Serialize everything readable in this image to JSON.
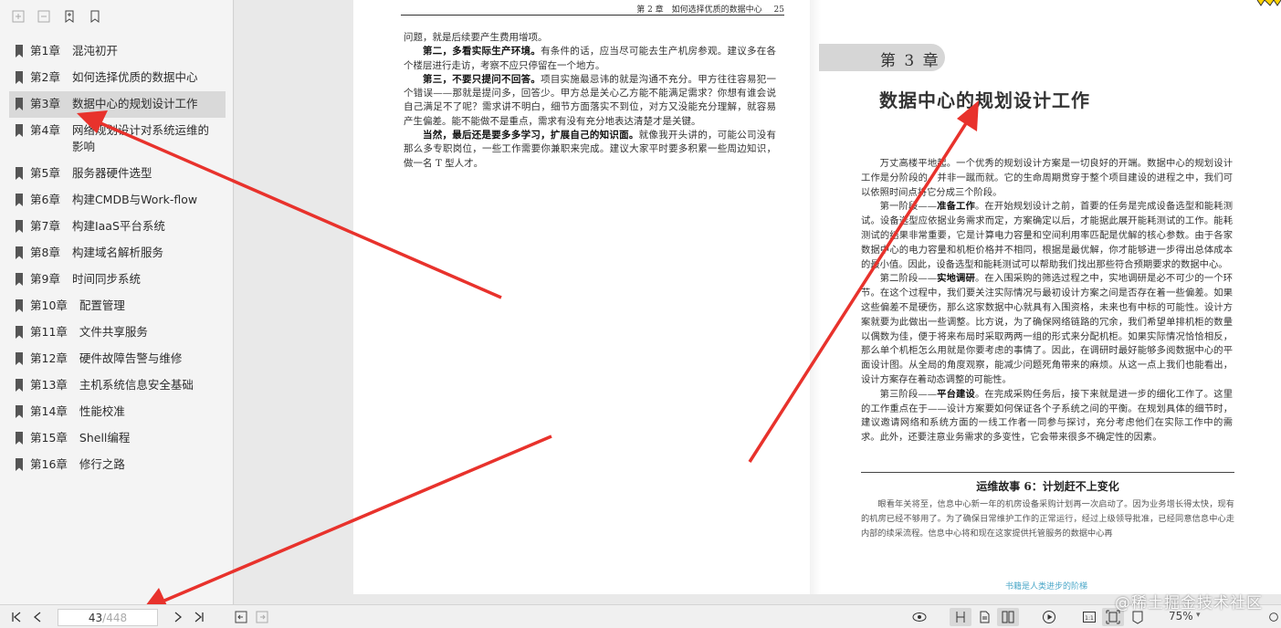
{
  "sidebar": {
    "toolbar": [
      {
        "icon": "expand-all-icon"
      },
      {
        "icon": "collapse-all-icon"
      },
      {
        "icon": "add-bookmark-icon"
      },
      {
        "icon": "bookmark-icon"
      }
    ],
    "toc": [
      {
        "num": "第1章",
        "title": "混沌初开"
      },
      {
        "num": "第2章",
        "title": "如何选择优质的数据中心"
      },
      {
        "num": "第3章",
        "title": "数据中心的规划设计工作",
        "active": true
      },
      {
        "num": "第4章",
        "title": "网络规划设计对系统运维的影响"
      },
      {
        "num": "第5章",
        "title": "服务器硬件选型"
      },
      {
        "num": "第6章",
        "title": "构建CMDB与Work-flow"
      },
      {
        "num": "第7章",
        "title": "构建IaaS平台系统"
      },
      {
        "num": "第8章",
        "title": "构建域名解析服务"
      },
      {
        "num": "第9章",
        "title": "时间同步系统"
      },
      {
        "num": "第10章",
        "title": "配置管理"
      },
      {
        "num": "第11章",
        "title": "文件共享服务"
      },
      {
        "num": "第12章",
        "title": "硬件故障告警与维修"
      },
      {
        "num": "第13章",
        "title": "主机系统信息安全基础"
      },
      {
        "num": "第14章",
        "title": "性能校准"
      },
      {
        "num": "第15章",
        "title": "Shell编程"
      },
      {
        "num": "第16章",
        "title": "修行之路"
      }
    ]
  },
  "left_page": {
    "header": "第 2 章　如何选择优质的数据中心",
    "page_number": "25",
    "p1": "问题，就是后续要产生费用增项。",
    "p2_bold": "第二，多看实际生产环境。",
    "p2": "有条件的话，应当尽可能去生产机房参观。建议多在各个楼层进行走访，考察不应只停留在一个地方。",
    "p3_bold": "第三，不要只提问不回答。",
    "p3": "项目实施最忌讳的就是沟通不充分。甲方往往容易犯一个错误——那就是提问多，回答少。甲方总是关心乙方能不能满足需求？你想有谁会说自己满足不了呢？需求讲不明白，细节方面落实不到位，对方又没能充分理解，就容易产生偏差。能不能做不是重点，需求有没有充分地表达清楚才是关键。",
    "p4_bold": "当然，最后还是要多多学习，扩展自己的知识面。",
    "p4": "就像我开头讲的，可能公司没有那么多专职岗位，一些工作需要你兼职来完成。建议大家平时要多积累一些周边知识，做一名 T 型人才。"
  },
  "right_page": {
    "chapter_tab": "第 3 章",
    "chapter_title": "数据中心的规划设计工作",
    "p1": "万丈高楼平地起。一个优秀的规划设计方案是一切良好的开端。数据中心的规划设计工作是分阶段的，并非一蹴而就。它的生命周期贯穿于整个项目建设的进程之中，我们可以依照时间点将它分成三个阶段。",
    "p2_pre": "第一阶段——",
    "p2_bold": "准备工作",
    "p2": "。在开始规划设计之前，首要的任务是完成设备选型和能耗测试。设备选型应依据业务需求而定，方案确定以后，才能据此展开能耗测试的工作。能耗测试的结果非常重要，它是计算电力容量和空间利用率匹配是优解的核心参数。由于各家数据中心的电力容量和机柜价格并不相同，根据是最优解，你才能够进一步得出总体成本的最小值。因此，设备选型和能耗测试可以帮助我们找出那些符合预期要求的数据中心。",
    "p3_pre": "第二阶段——",
    "p3_bold": "实地调研",
    "p3": "。在入围采购的筛选过程之中，实地调研是必不可少的一个环节。在这个过程中，我们要关注实际情况与最初设计方案之间是否存在着一些偏差。如果这些偏差不是硬伤，那么这家数据中心就具有入围资格，未来也有中标的可能性。设计方案就要为此做出一些调整。比方说，为了确保网络链路的冗余，我们希望单排机柜的数量以偶数为佳，便于将来布局时采取两两一组的形式来分配机柜。如果实际情况恰恰相反，那么单个机柜怎么用就是你要考虑的事情了。因此，在调研时最好能够多阅数据中心的平面设计图。从全局的角度观察，能减少问题死角带来的麻烦。从这一点上我们也能看出，设计方案存在着动态调整的可能性。",
    "p4_pre": "第三阶段——",
    "p4_bold": "平台建设",
    "p4": "。在完成采购任务后，接下来就是进一步的细化工作了。这里的工作重点在于——设计方案要如何保证各个子系统之间的平衡。在规划具体的细节时，建议邀请网络和系统方面的一线工作者一同参与探讨，充分考虑他们在实际工作中的需求。此外，还要注意业务需求的多变性，它会带来很多不确定性的因素。",
    "story_title": "运维故事 6：计划赶不上变化",
    "story_text": "眼看年关将至，信息中心新一年的机房设备采购计划再一次启动了。因为业务增长得太快，现有的机房已经不够用了。为了确保日常维护工作的正常运行，经过上级领导批准，已经同意信息中心走内部的续采流程。信息中心将和现在这家提供托管服务的数据中心再",
    "footer_slogan": "书籍是人类进步的阶梯"
  },
  "bottom_bar": {
    "current_page": "43",
    "total_pages": "/448",
    "zoom": "75%",
    "watermark": "@稀土掘金技术社区",
    "buttons": [
      "first-page-icon",
      "prev-page-icon",
      "next-page-icon",
      "last-page-icon",
      "back-icon",
      "forward-icon",
      "eye-icon",
      "single-page-icon",
      "continuous-page-icon",
      "two-page-icon",
      "play-icon",
      "actual-size-icon",
      "fit-page-icon",
      "fit-width-icon",
      "zoom-slider-icon"
    ]
  },
  "colors": {
    "arrow": "#e8322c",
    "sidebar_bg": "#f4f4f4",
    "active_item": "#d9d9d9",
    "chapter_tab": "#d6d6d6",
    "slogan": "#4aa7c8"
  }
}
